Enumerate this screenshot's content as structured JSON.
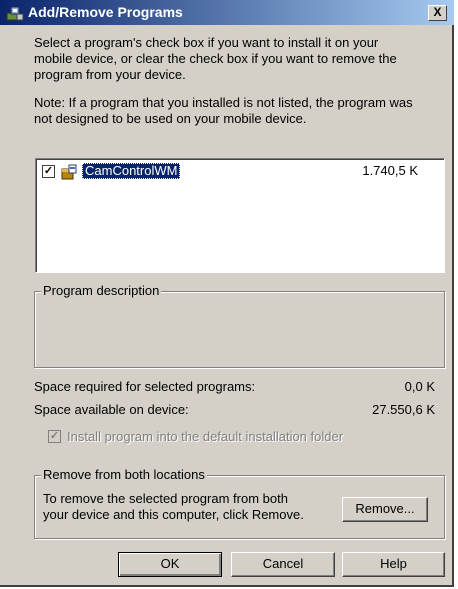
{
  "window": {
    "title": "Add/Remove Programs",
    "close_label": "X"
  },
  "instructions": {
    "line1": "Select a program's check box if you want to install it on your",
    "line2": "mobile device, or clear the check box if you want to remove the",
    "line3": "program from your device."
  },
  "note": {
    "line1": "Note:  If a program that you installed is not listed, the program was",
    "line2": "not designed to be used on your mobile device."
  },
  "programs": [
    {
      "name": "CamControlWM",
      "size": "1.740,5 K",
      "checked": true,
      "selected": true
    }
  ],
  "description_group": {
    "label": "Program description",
    "text": ""
  },
  "space": {
    "required_label": "Space required for selected programs:",
    "required_value": "0,0 K",
    "available_label": "Space available on device:",
    "available_value": "27.550,6 K"
  },
  "install_default": {
    "label": "Install program into the default installation folder",
    "checked": true,
    "enabled": false
  },
  "remove_group": {
    "label": "Remove from both locations",
    "text_line1": "To remove the selected program from both",
    "text_line2": "your device and this computer, click Remove.",
    "button_label": "Remove..."
  },
  "buttons": {
    "ok": "OK",
    "cancel": "Cancel",
    "help": "Help"
  },
  "icons": {
    "title": "add-remove-programs-icon",
    "program": "program-box-icon"
  }
}
